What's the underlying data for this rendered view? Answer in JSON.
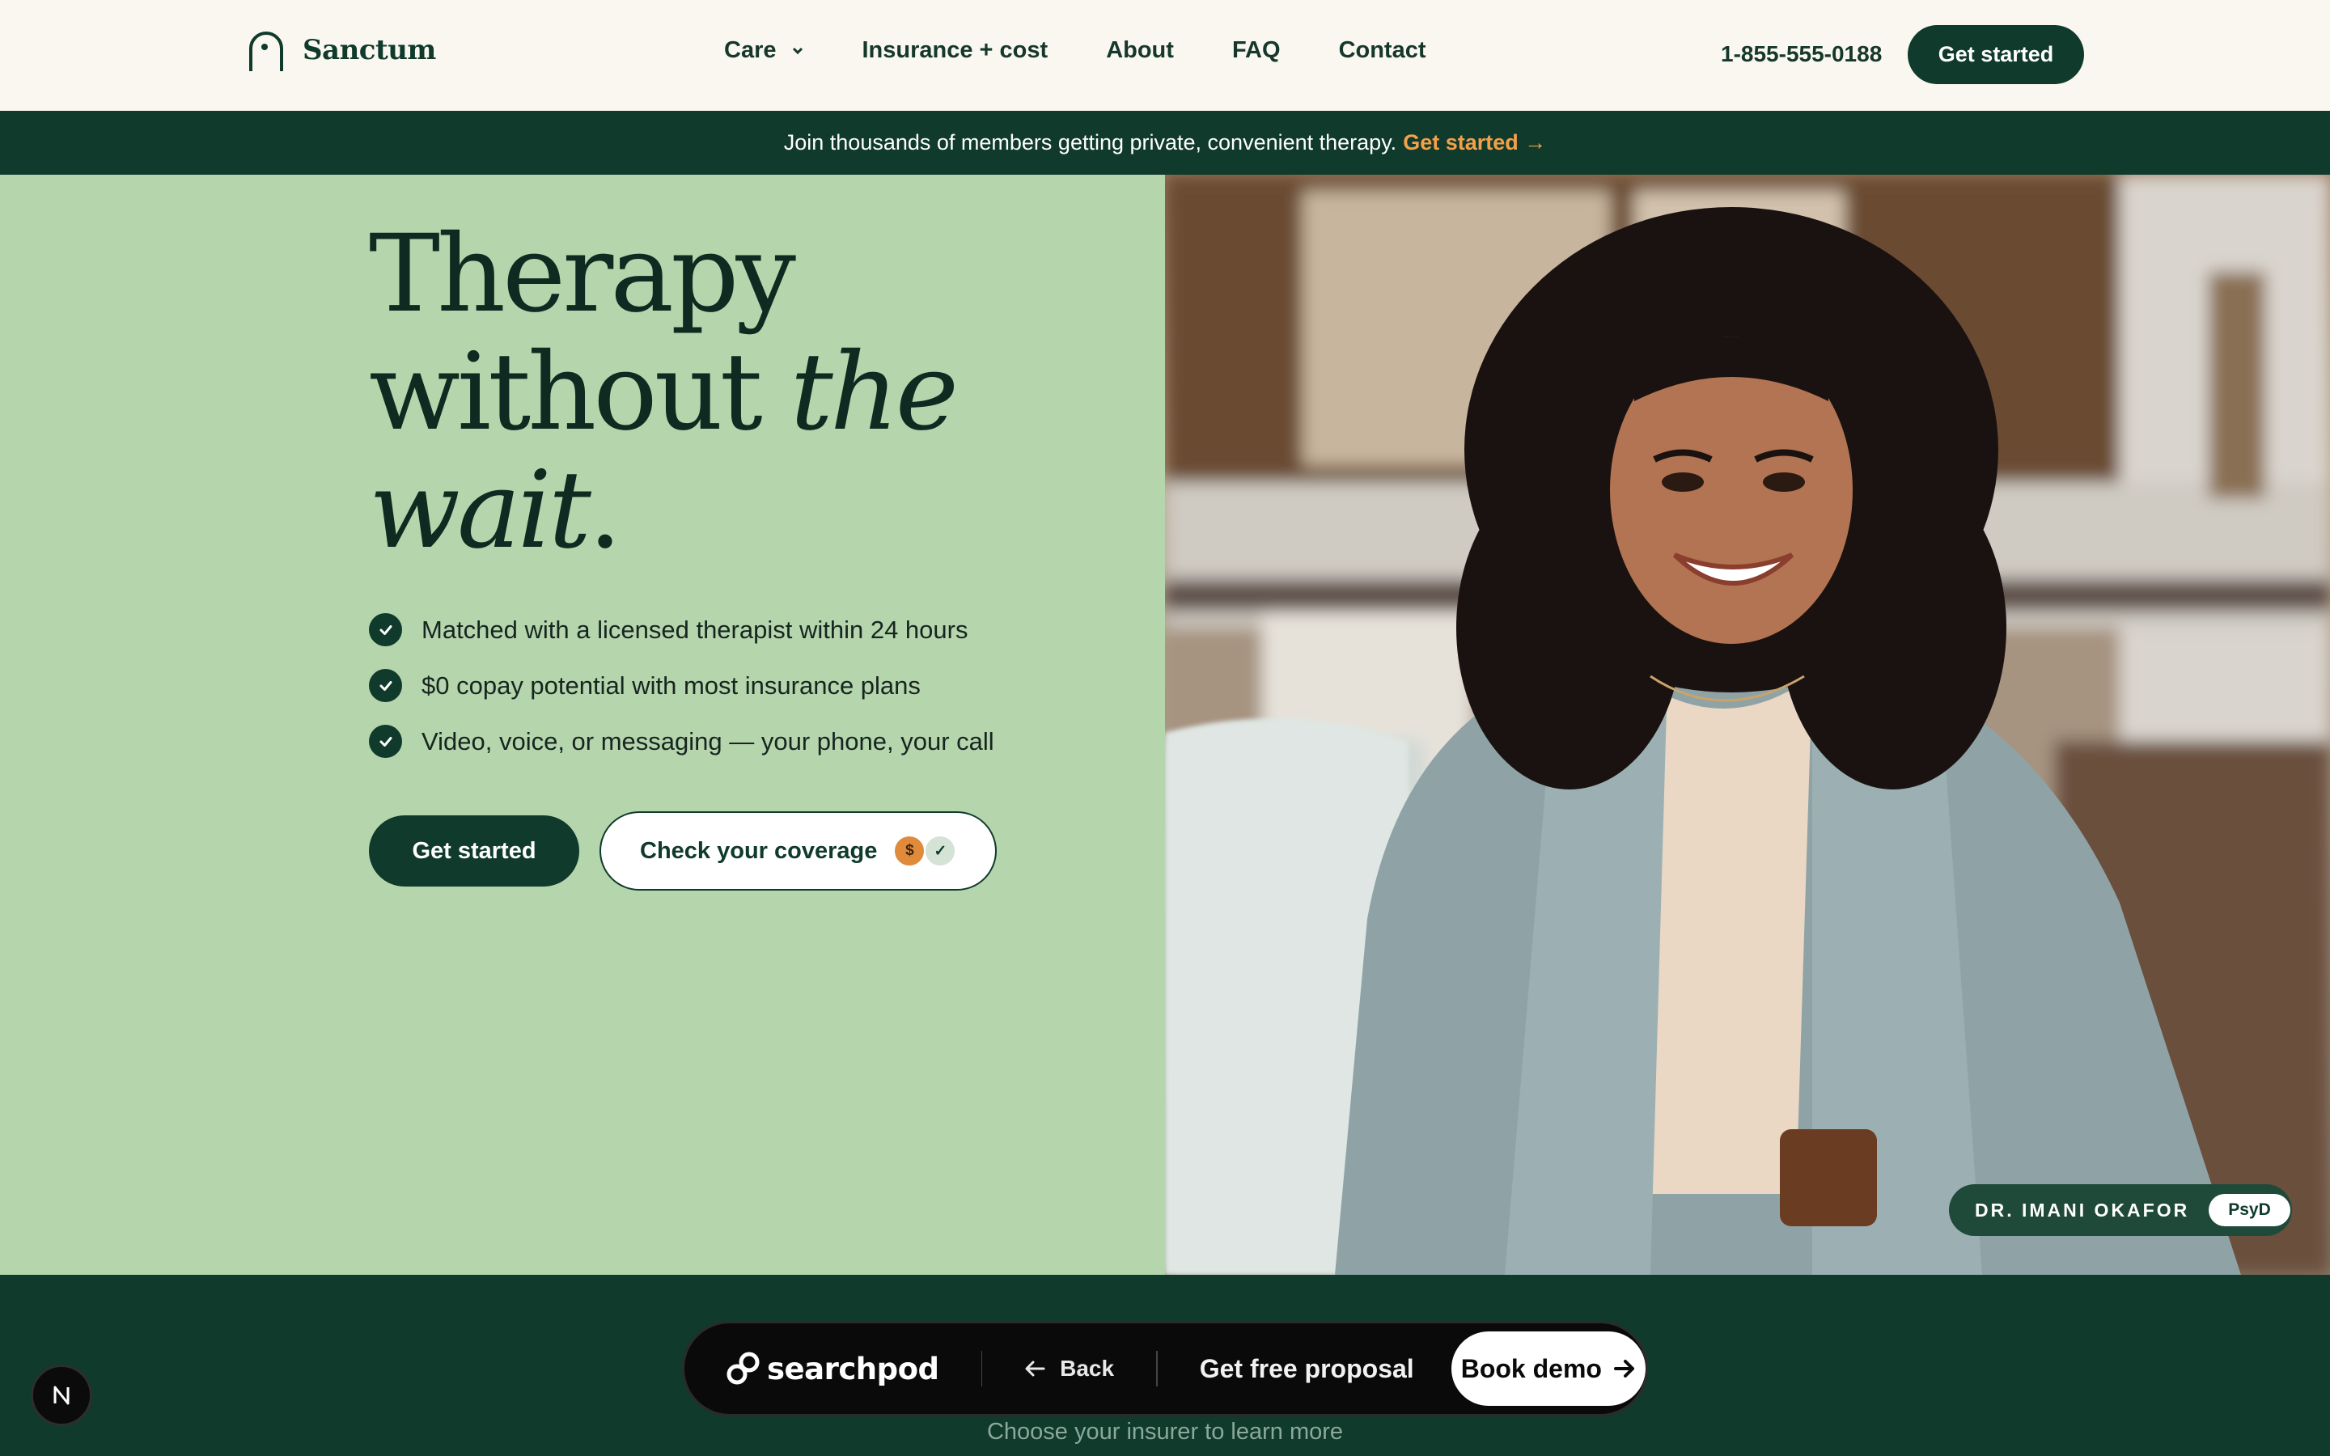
{
  "brand": {
    "name": "Sanctum",
    "logo_icon": "arch-logo-icon"
  },
  "nav": {
    "items": [
      {
        "label": "Care",
        "has_dropdown": true
      },
      {
        "label": "Insurance + cost"
      },
      {
        "label": "About"
      },
      {
        "label": "FAQ"
      },
      {
        "label": "Contact"
      }
    ],
    "phone": "1-855-555-0188",
    "cta": "Get started"
  },
  "announcement": {
    "text": "Join thousands of members getting private, convenient therapy.",
    "link": "Get started →"
  },
  "hero": {
    "headline_line1": "Therapy",
    "headline_line2_plain": "without ",
    "headline_line2_italic": "the",
    "headline_line3_italic": "wait",
    "headline_line3_plain": ".",
    "features": [
      "Matched with a licensed therapist within 24 hours",
      "$0 copay potential with most insurance plans",
      "Video, voice, or messaging — your phone, your call"
    ],
    "primary_cta": "Get started",
    "secondary_cta": "Check your coverage",
    "coverage_icons": [
      "$",
      "✓"
    ],
    "therapist_name": "DR. IMANI OKAFOR",
    "therapist_credential": "PsyD"
  },
  "bottom_bar": {
    "brand": "searchpod",
    "back": "Back",
    "proposal": "Get free proposal",
    "demo": "Book demo",
    "hint": "Choose your insurer to learn more"
  },
  "colors": {
    "primary": "#0f3a2c",
    "hero_bg": "#b5d5ad",
    "header_bg": "#faf7f0",
    "accent": "#f4a04a"
  }
}
